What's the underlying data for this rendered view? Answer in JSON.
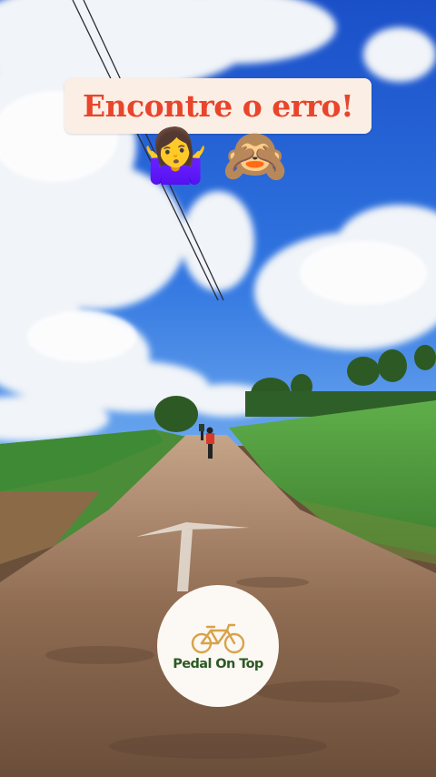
{
  "overlay": {
    "title": "Encontre o erro!",
    "emojis": [
      {
        "icon": "person-shrugging-emoji",
        "glyph": "🤷‍♀️"
      },
      {
        "icon": "see-no-evil-monkey-emoji",
        "glyph": "🙈"
      }
    ]
  },
  "logo": {
    "icon": "bicycle-icon",
    "brand": "Pedal On Top",
    "brand_color": "#2c5a22",
    "bike_color": "#d8a24a"
  },
  "colors": {
    "title_text": "#e8452c",
    "title_background": "#fbeee4",
    "sky": "#1f5fd6"
  }
}
